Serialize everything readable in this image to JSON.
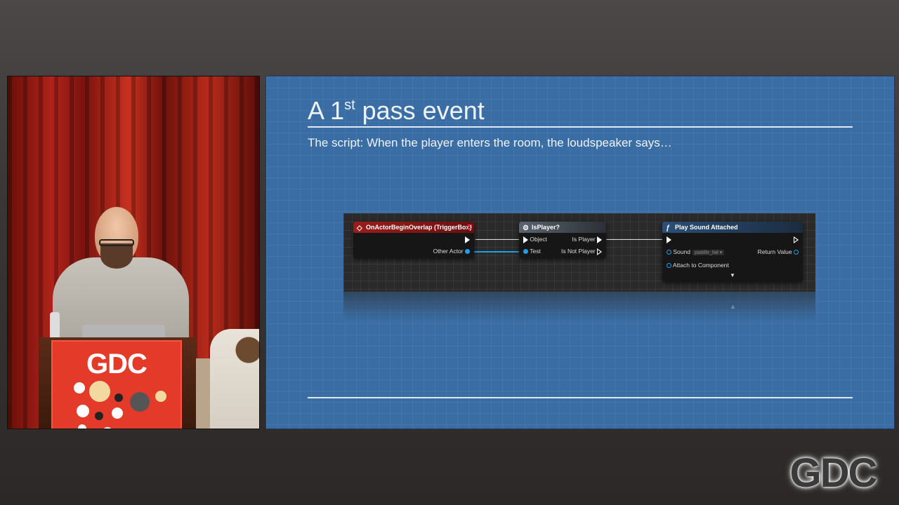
{
  "slide": {
    "title_main": "A 1",
    "title_sup": "st",
    "title_rest": " pass event",
    "subtitle": "The script: When the player enters the room, the loudspeaker says…"
  },
  "nodes": {
    "event": {
      "title": "OnActorBeginOverlap (TriggerBox)",
      "other_actor": "Other Actor",
      "icon": "event-diamond-icon"
    },
    "is_player": {
      "title": "IsPlayer?",
      "object": "Object",
      "test": "Test",
      "is_player": "Is Player",
      "is_not_player": "Is Not Player",
      "icon": "gear-icon"
    },
    "play_sound": {
      "title": "Play Sound Attached",
      "sound": "Sound",
      "sound_value": "paddle_fail",
      "return_value": "Return Value",
      "attach": "Attach to Component",
      "icon": "function-icon"
    }
  },
  "branding": {
    "podium_logo": "GDC",
    "corner_logo": "GDC"
  },
  "colors": {
    "slide_bg": "#3a6da3",
    "event_header": "#9c1c1c",
    "data_pin": "#1f9fe8"
  }
}
